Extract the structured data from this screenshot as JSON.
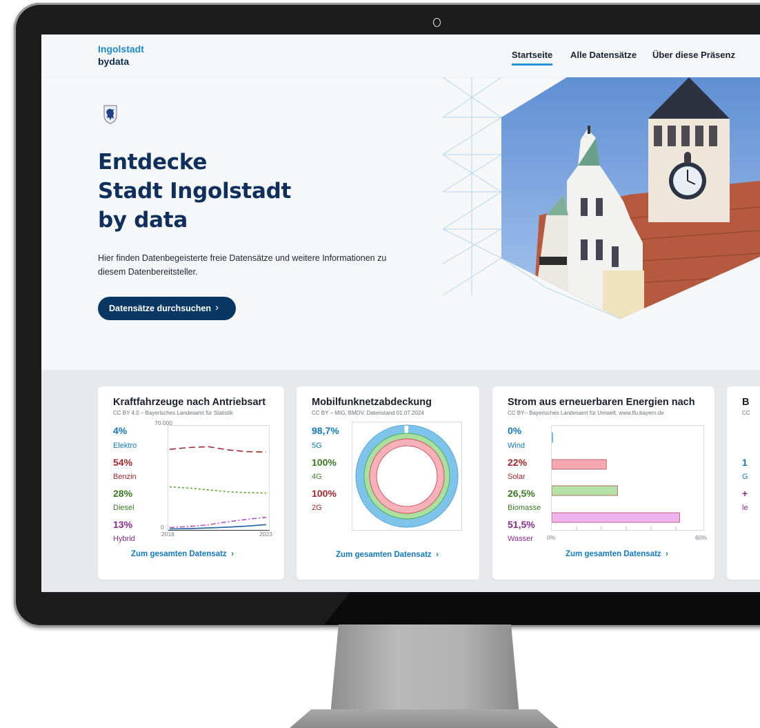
{
  "header": {
    "logo_line1": "Ingolstadt",
    "logo_line2": "bydata",
    "nav": [
      {
        "label": "Startseite",
        "active": true
      },
      {
        "label": "Alle Datensätze",
        "active": false
      },
      {
        "label": "Über diese Präsenz",
        "active": false
      }
    ]
  },
  "hero": {
    "title_line1": "Entdecke",
    "title_line2": "Stadt Ingolstadt",
    "title_line3": "by data",
    "intro_line1": "Hier finden Datenbegeisterte freie Datensätze und weitere Informationen zu",
    "intro_line2": "diesem Datenbereitsteller.",
    "cta_label": "Datensätze durchsuchen",
    "cta_icon": "chevron-right-icon"
  },
  "cards": [
    {
      "title": "Kraftfahrzeuge nach Antriebsart",
      "source": "CC BY 4.0 – Bayerisches Landesamt für Statistik",
      "stats": [
        {
          "value": "4%",
          "label": "Elektro",
          "color": "#1479c2"
        },
        {
          "value": "54%",
          "label": "Benzin",
          "color": "#a4262c"
        },
        {
          "value": "28%",
          "label": "Diesel",
          "color": "#3b7a25"
        },
        {
          "value": "13%",
          "label": "Hybrid",
          "color": "#8b2a8f"
        }
      ],
      "link": "Zum gesamten Datensatz"
    },
    {
      "title": "Mobilfunknetzabdeckung",
      "source": "CC BY – MIG, BMDV. Datenstand 01.07.2024",
      "stats": [
        {
          "value": "98,7%",
          "label": "5G",
          "color": "#1479c2"
        },
        {
          "value": "100%",
          "label": "4G",
          "color": "#3b7a25"
        },
        {
          "value": "100%",
          "label": "2G",
          "color": "#a4262c"
        }
      ],
      "link": "Zum gesamten Datensatz"
    },
    {
      "title": "Strom aus erneuerbaren Energien nach",
      "source": "CC BY– Bayerisches Landesamt für Umwelt, www.lfu.bayern.de",
      "stats": [
        {
          "value": "0%",
          "label": "Wind",
          "color": "#1479c2"
        },
        {
          "value": "22%",
          "label": "Solar",
          "color": "#a4262c"
        },
        {
          "value": "26,5%",
          "label": "Biomasse",
          "color": "#3b7a25"
        },
        {
          "value": "51,5%",
          "label": "Wasser",
          "color": "#8b2a8f"
        }
      ],
      "link": "Zum gesamten Datensatz"
    },
    {
      "title": "B",
      "source": "CC",
      "stats": [
        {
          "value": "1",
          "label": "G",
          "color": "#1479c2"
        },
        {
          "value": "+",
          "label": "le",
          "color": "#8b2a8f"
        }
      ]
    }
  ],
  "chart_data": [
    {
      "type": "line",
      "x": [
        2018,
        2019,
        2020,
        2021,
        2022,
        2023
      ],
      "xticks": [
        "2018",
        "2023"
      ],
      "yticks": [
        "0",
        "70.000"
      ],
      "ylim": [
        0,
        70000
      ],
      "series": [
        {
          "name": "Benzin",
          "values": [
            55500,
            56800,
            57400,
            55200,
            53900,
            53700
          ],
          "color": "#a4262c",
          "style": "dashed"
        },
        {
          "name": "Diesel",
          "values": [
            29500,
            28600,
            27400,
            26100,
            25400,
            25200
          ],
          "color": "#5aa831",
          "style": "dotted"
        },
        {
          "name": "Hybrid",
          "values": [
            1200,
            1900,
            3100,
            5200,
            6900,
            8300
          ],
          "color": "#b24fc8",
          "style": "dashdot"
        },
        {
          "name": "Elektro",
          "values": [
            250,
            450,
            900,
            1500,
            2200,
            3200
          ],
          "color": "#1a5f9e",
          "style": "solid"
        }
      ]
    },
    {
      "type": "pie",
      "categories": [
        "5G",
        "4G",
        "2G"
      ],
      "values": [
        98.7,
        100,
        100
      ],
      "colors": [
        "#7ec3ea",
        "#a9e0a0",
        "#f7b1b8"
      ]
    },
    {
      "type": "bar",
      "orientation": "horizontal",
      "categories": [
        "Wind",
        "Solar",
        "Biomasse",
        "Wasser"
      ],
      "values": [
        0,
        22,
        26.5,
        51.5
      ],
      "colors": [
        "#9bd0f0",
        "#f6a7b0",
        "#b5e3a6",
        "#efb3ef"
      ],
      "xlim": [
        0,
        60
      ],
      "xticks": [
        "0%",
        "60%"
      ]
    }
  ]
}
